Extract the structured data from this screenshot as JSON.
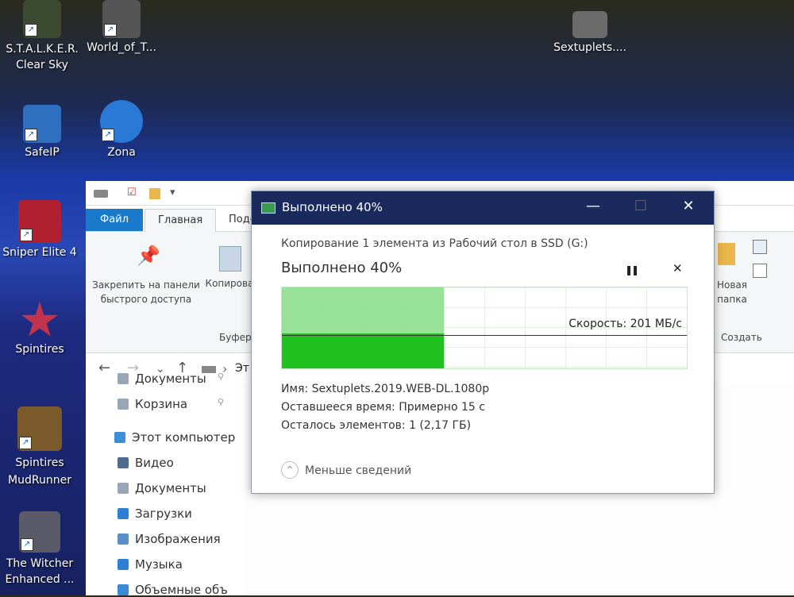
{
  "desktop": {
    "icons": [
      {
        "label": "S.T.A.L.K.E.R.\nClear Sky",
        "color": "#3c4a30"
      },
      {
        "label": "World_of_T...",
        "color": "#555"
      },
      {
        "label": "Sextuplets....",
        "color": "#6b6b6b"
      },
      {
        "label": "SafeIP",
        "color": "#2f6fbf"
      },
      {
        "label": "Zona",
        "color": "#2a79d6"
      },
      {
        "label": "Sniper Elite 4",
        "color": "#b02030"
      },
      {
        "label": "Spintires",
        "color": "#c2334d"
      },
      {
        "label": "Spintires\nMudRunner",
        "color": "#7a5a2a"
      },
      {
        "label": "The Witcher\nEnhanced ...",
        "color": "#5a5a6a"
      }
    ],
    "shortcut_glyph": "↗"
  },
  "explorer": {
    "tabs": [
      "Файл",
      "Главная",
      "Поде"
    ],
    "ribbon": {
      "pin_label": "Закрепить на панели быстрого доступа",
      "copy_label": "Копирова",
      "clipboard_group": "Буфер",
      "new_folder": "Новая папка",
      "create_group": "Создать"
    },
    "address": "Эт",
    "nav_items": [
      {
        "label": "Документы",
        "color": "#9aa6b8"
      },
      {
        "label": "Корзина",
        "color": "#9aa6b8"
      },
      {
        "label": "Этот компьютер",
        "color": "#3b8ed8"
      },
      {
        "label": "Видео",
        "color": "#4f6a8f"
      },
      {
        "label": "Документы",
        "color": "#9aa6b8"
      },
      {
        "label": "Загрузки",
        "color": "#2f7fd6"
      },
      {
        "label": "Изображения",
        "color": "#5a8fc8"
      },
      {
        "label": "Музыка",
        "color": "#2f7fd6"
      },
      {
        "label": "Объемные объ",
        "color": "#3a8ad8"
      }
    ]
  },
  "dialog": {
    "title": "Выполнено 40%",
    "copy_line": "Копирование 1 элемента из Рабочий стол в SSD (G:)",
    "heading": "Выполнено 40%",
    "pause": "❚❚",
    "cancel": "✕",
    "speed": "Скорость: 201 МБ/с",
    "progress": 0.4,
    "name_line": "Имя:  Sextuplets.2019.WEB-DL.1080p",
    "time_line": "Оставшееся время:  Примерно 15 с",
    "items_line": "Осталось элементов:  1 (2,17 ГБ)",
    "less_details": "Меньше сведений",
    "chevron": "⌃"
  },
  "colors": {
    "accent": "#1979ca",
    "progress": "#1fc21f",
    "titlebar": "#1a2a5c"
  }
}
